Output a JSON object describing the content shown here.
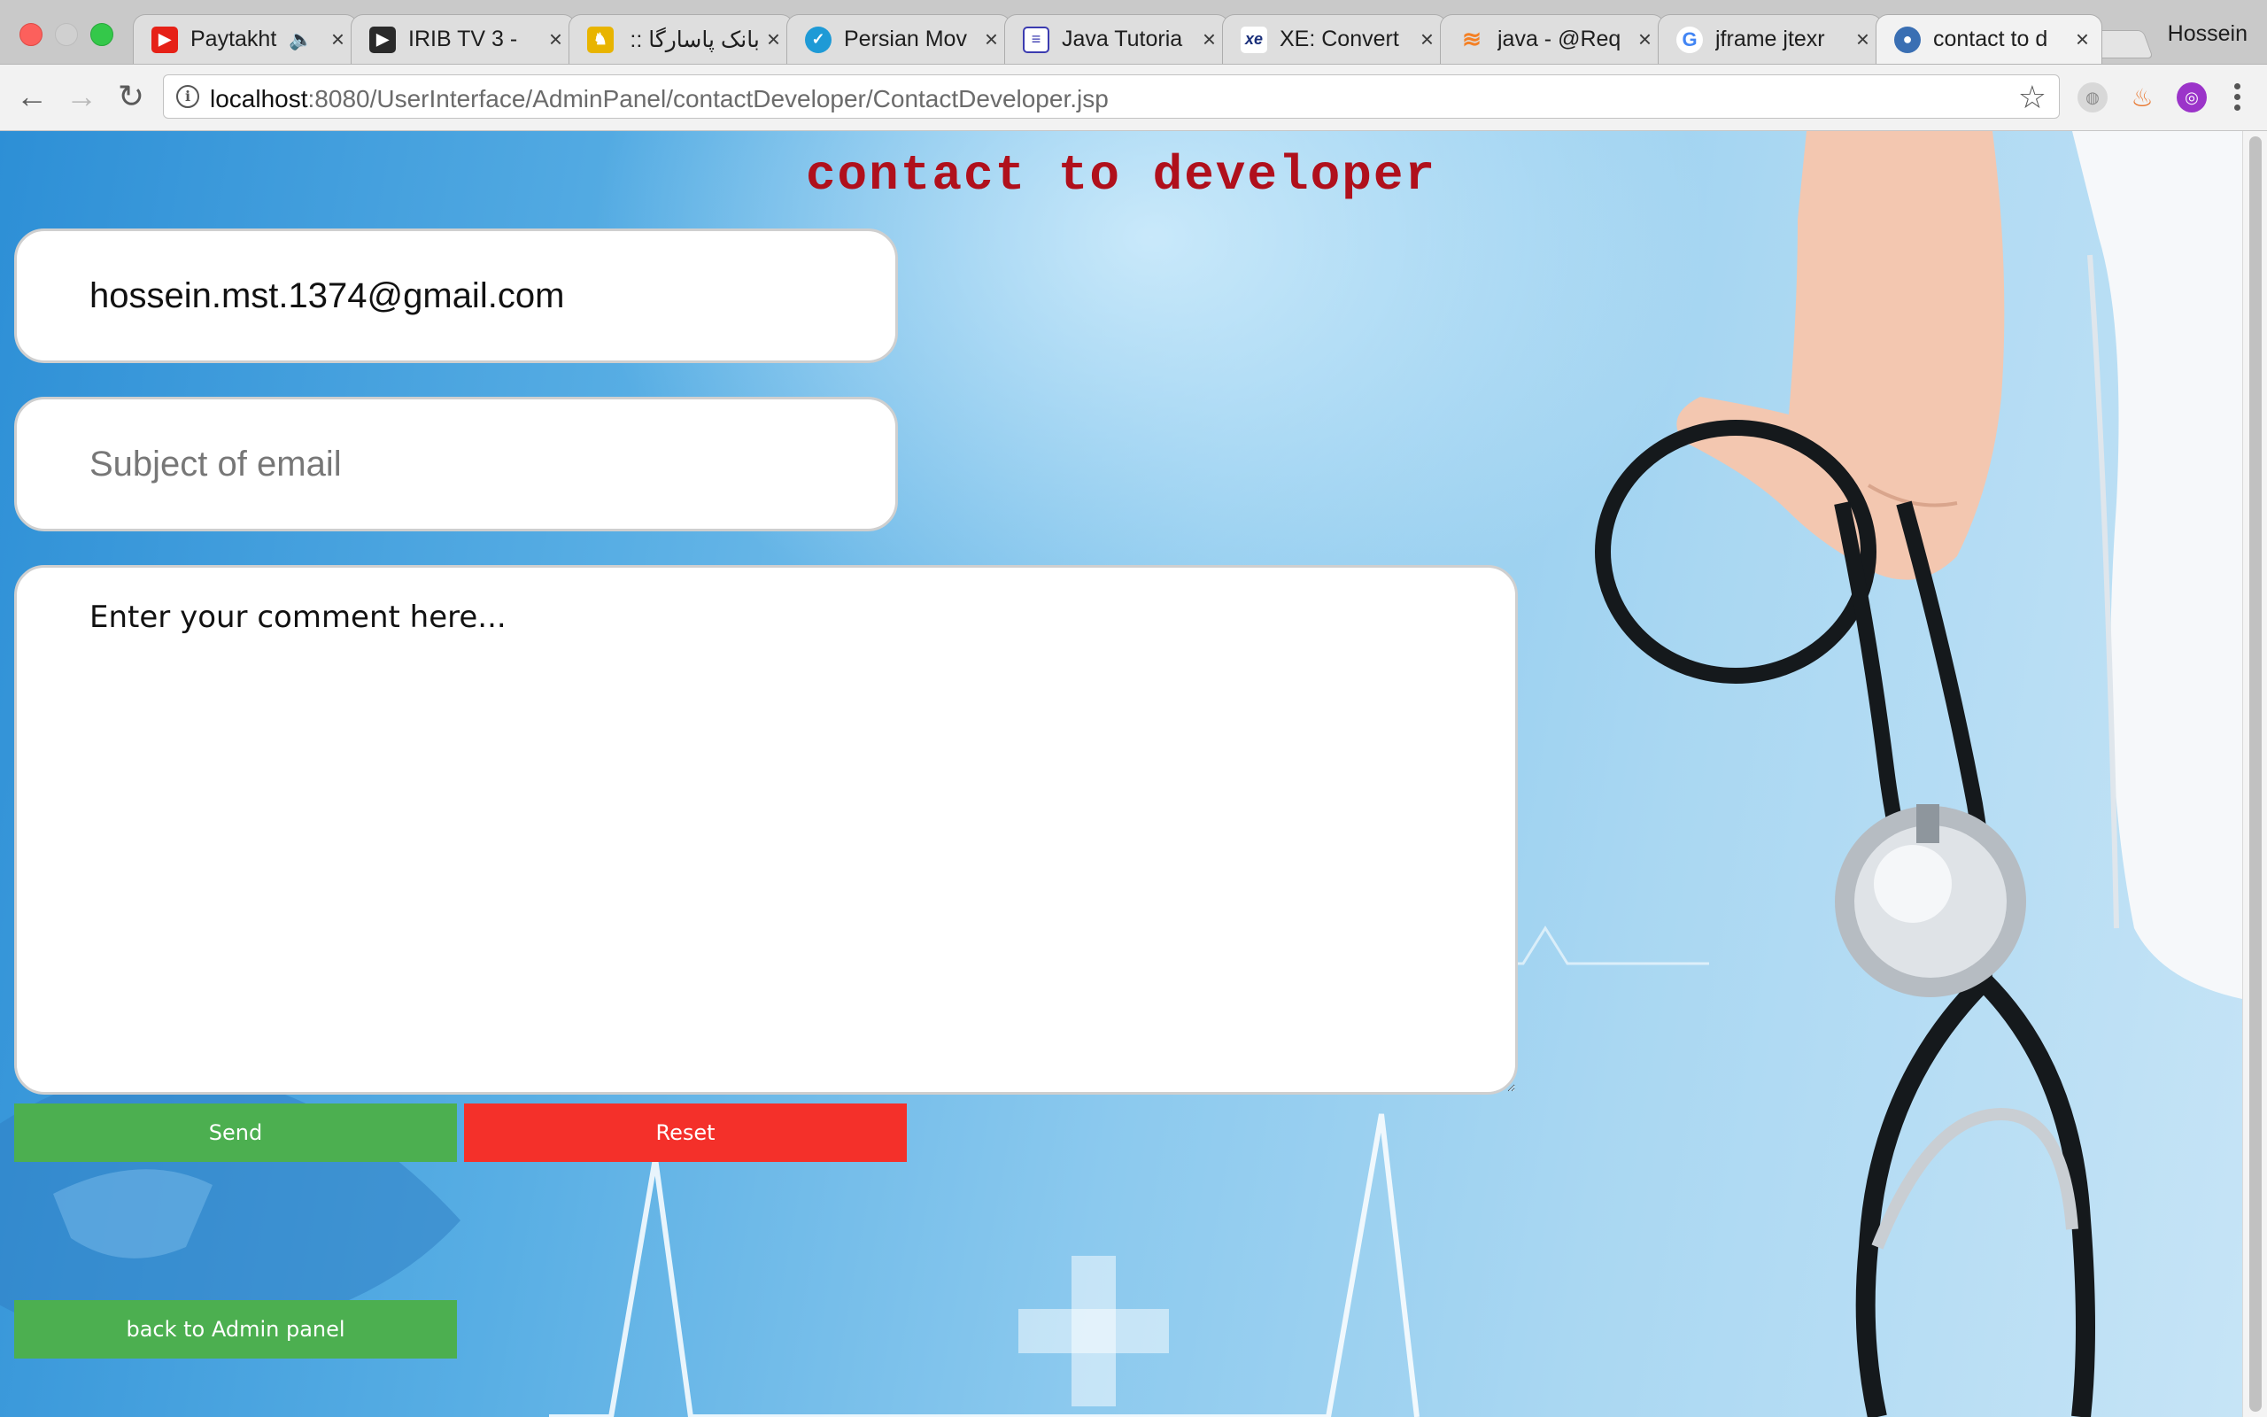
{
  "browser": {
    "tabs": [
      {
        "title": "Paytakht",
        "favicon": "youtube-icon",
        "audio": true
      },
      {
        "title": "IRIB TV 3 - ",
        "favicon": "play-icon"
      },
      {
        "title": "بانک پاسارگا :: ",
        "favicon": "bank-icon"
      },
      {
        "title": "Persian Mov",
        "favicon": "bird-icon"
      },
      {
        "title": "Java Tutoria",
        "favicon": "tutorial-icon"
      },
      {
        "title": "XE: Convert",
        "favicon": "xe-icon"
      },
      {
        "title": "java - @Req",
        "favicon": "stackoverflow-icon"
      },
      {
        "title": "jframe jtexr",
        "favicon": "google-icon"
      },
      {
        "title": "contact to d",
        "favicon": "user-icon",
        "active": true
      }
    ],
    "profile_name": "Hossein",
    "url": {
      "host": "localhost",
      "path": ":8080/UserInterface/AdminPanel/contactDeveloper/ContactDeveloper.jsp"
    }
  },
  "page": {
    "title": "contact to developer",
    "email_value": "hossein.mst.1374@gmail.com",
    "subject_placeholder": "Subject of email",
    "comment_placeholder": "Enter your comment here...",
    "send_label": "Send",
    "reset_label": "Reset",
    "back_label": "back to Admin panel"
  },
  "colors": {
    "title": "#b0101c",
    "send_button": "#4caf50",
    "reset_button": "#f4302a",
    "back_button": "#4caf50"
  }
}
